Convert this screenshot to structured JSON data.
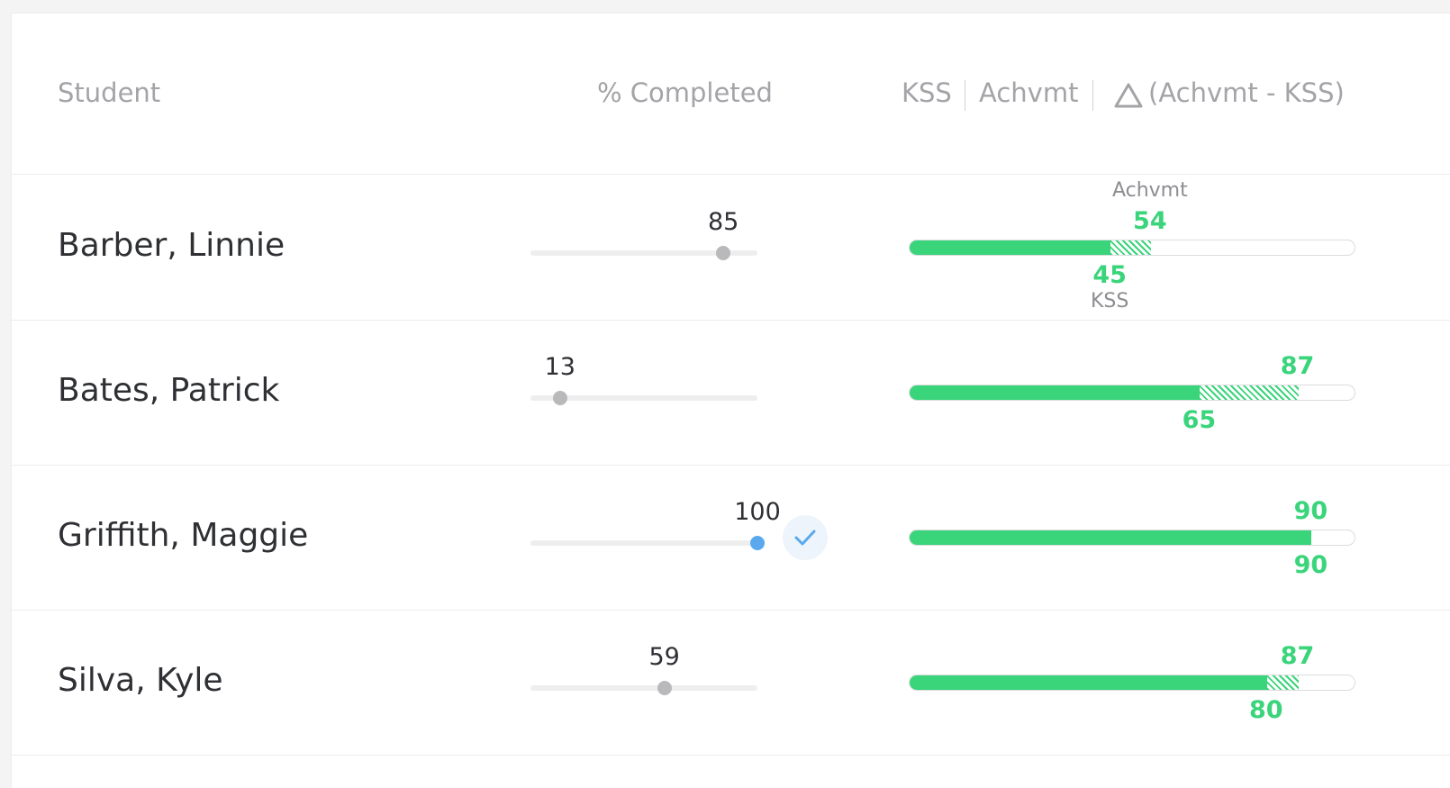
{
  "header": {
    "student": "Student",
    "completed": "% Completed",
    "kss": "KSS",
    "achvmt": "Achvmt",
    "delta": "(Achvmt - KSS)"
  },
  "colors": {
    "below": "#ff8c00",
    "above": "#3ad47b",
    "slider_thumb": "#b9b9bc",
    "slider_thumb_done": "#5aa9ee"
  },
  "students": [
    {
      "name": "Barber, Linnie",
      "completed": 85,
      "kss": 45,
      "achvmt": 54,
      "complete_check": false,
      "kss_caption": "KSS",
      "achvmt_caption": "Achvmt"
    },
    {
      "name": "Bates, Patrick",
      "completed": 13,
      "kss": 65,
      "achvmt": 87,
      "complete_check": false
    },
    {
      "name": "Griffith, Maggie",
      "completed": 100,
      "kss": 90,
      "achvmt": 90,
      "complete_check": true
    },
    {
      "name": "Silva, Kyle",
      "completed": 59,
      "kss": 80,
      "achvmt": 87,
      "complete_check": false
    }
  ]
}
